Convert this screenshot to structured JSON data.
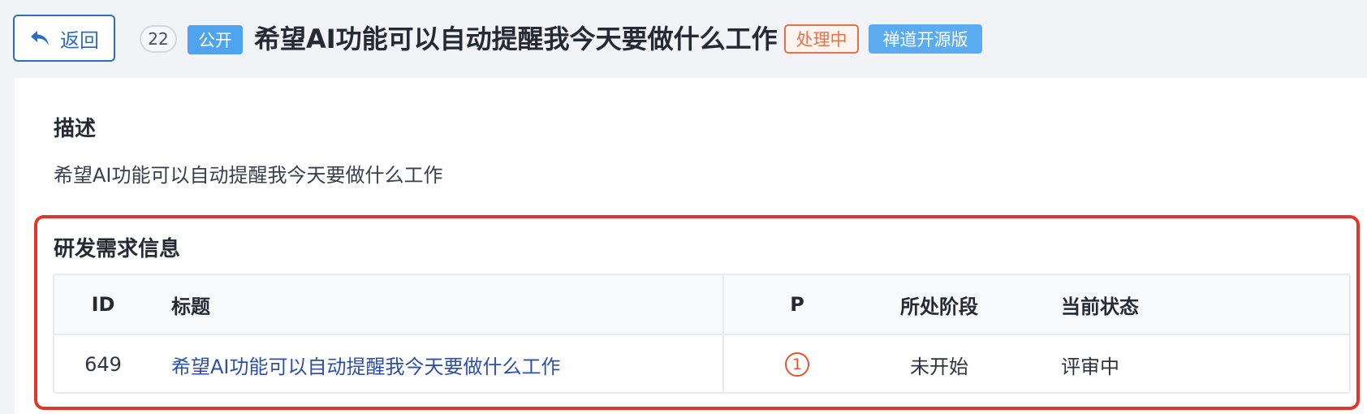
{
  "header": {
    "back_label": "返回",
    "id": "22",
    "visibility": "公开",
    "title": "希望AI功能可以自动提醒我今天要做什么工作",
    "status": "处理中",
    "edition": "禅道开源版"
  },
  "description": {
    "heading": "描述",
    "text": "希望AI功能可以自动提醒我今天要做什么工作"
  },
  "requirement_section": {
    "heading": "研发需求信息",
    "columns": [
      "ID",
      "标题",
      "P",
      "所处阶段",
      "当前状态"
    ],
    "rows": [
      {
        "id": "649",
        "title": "希望AI功能可以自动提醒我今天要做什么工作",
        "priority": "1",
        "stage": "未开始",
        "status": "评审中"
      }
    ]
  },
  "colors": {
    "accent": "#2e6bc5",
    "status_orange": "#e8714a",
    "highlight_red": "#e2362a",
    "badge_blue": "#4ea4ef"
  },
  "icons": {
    "back": "reply-arrow-icon"
  }
}
